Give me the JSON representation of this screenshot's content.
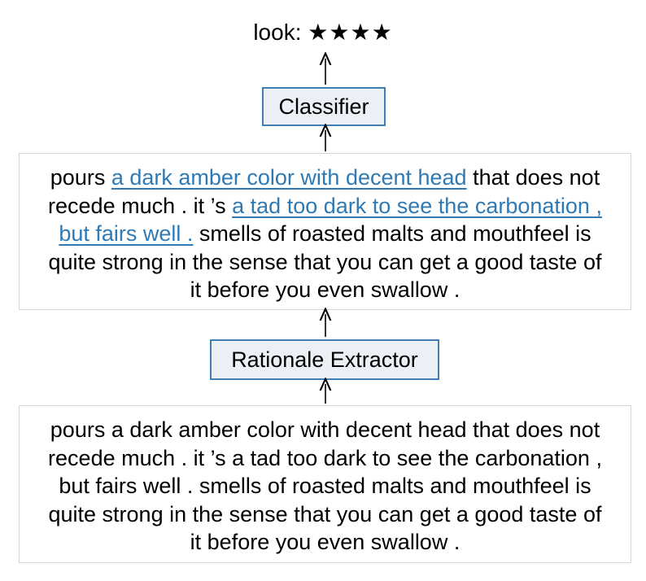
{
  "output": {
    "label": "look:",
    "stars": "★★★★",
    "rating": 4
  },
  "classifier": {
    "label": "Classifier"
  },
  "rationale_text": {
    "segments": [
      {
        "text": "pours ",
        "highlighted": false
      },
      {
        "text": "a dark amber color with decent head",
        "highlighted": true
      },
      {
        "text": " that does not recede much . it ’s ",
        "highlighted": false
      },
      {
        "text": "a tad too dark to see the carbonation , but fairs well .",
        "highlighted": true
      },
      {
        "text": " smells of roasted malts and mouthfeel is quite strong in the sense that you can get a good taste of it before you even swallow .",
        "highlighted": false
      }
    ]
  },
  "extractor": {
    "label": "Rationale Extractor"
  },
  "input_text": {
    "text": "pours a dark amber color with decent head that does not recede much . it ’s a tad too dark to see the carbonation , but fairs well . smells of roasted malts and mouthfeel is quite strong in the sense that you can get a good taste of it before you even swallow ."
  },
  "colors": {
    "module_fill": "#eaf0f6",
    "module_border": "#3f7fb5",
    "highlight": "#2f7ab4",
    "text_box_border": "#d6d6d6"
  }
}
